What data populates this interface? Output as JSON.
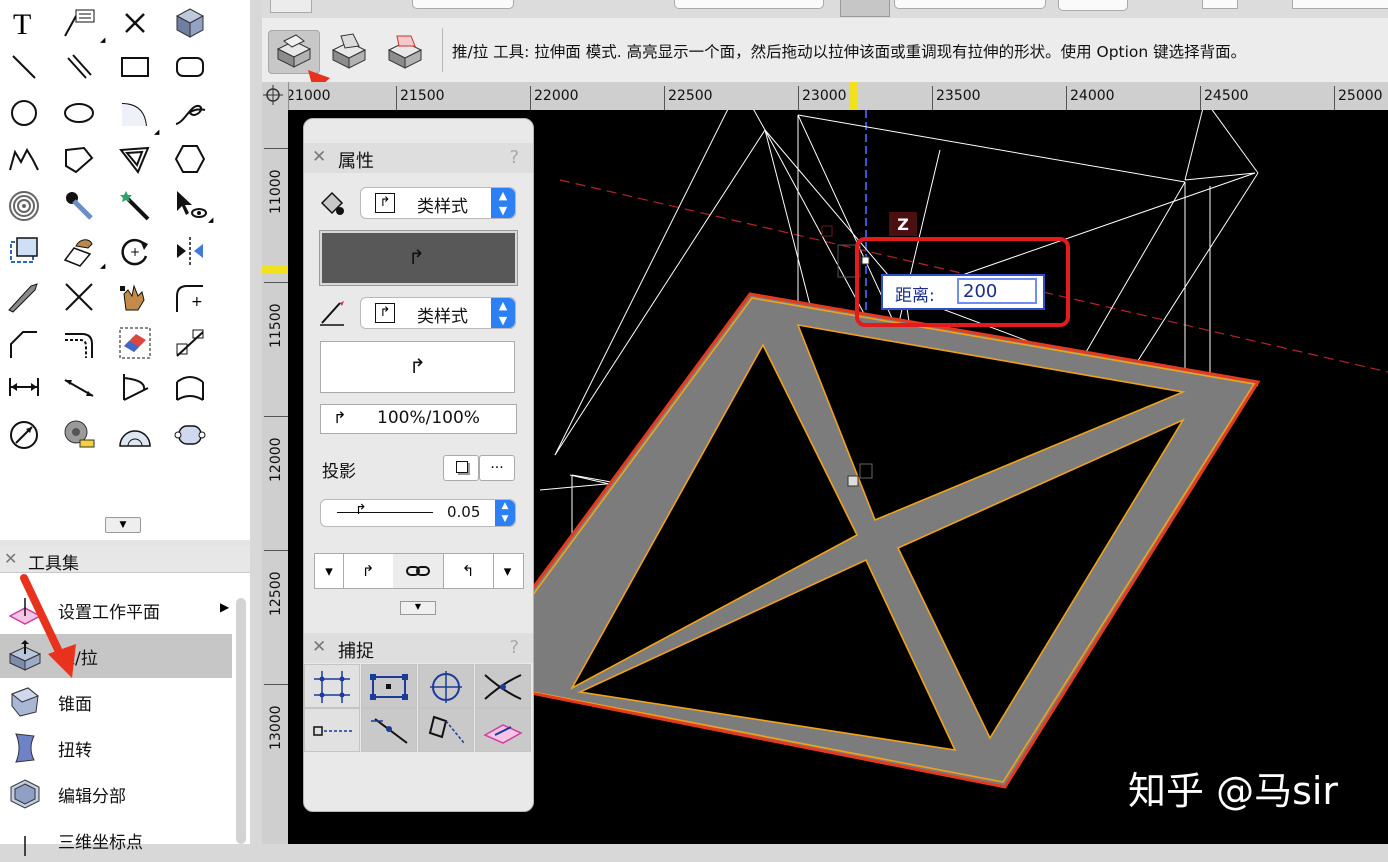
{
  "toolbar": {
    "hint_text": "推/拉 工具: 拉伸面 模式. 高亮显示一个面，然后拖动以拉伸该面或重调现有拉伸的形状。使用 Option 键选择背面。"
  },
  "palette": {
    "icons": [
      "text-icon",
      "callout-icon",
      "locus-icon",
      "3d-locus-icon",
      "line-icon",
      "double-line-icon",
      "rectangle-icon",
      "rounded-rectangle-icon",
      "circle-icon",
      "oval-icon",
      "arc-icon",
      "freehand-icon",
      "polyline-icon",
      "polygon-icon",
      "double-polygon-icon",
      "regular-polygon-icon",
      "spiral-icon",
      "eyedropper-icon",
      "visibility-wand-icon",
      "flyover-icon",
      "clip-icon",
      "attribute-mapping-icon",
      "rotate-icon",
      "mirror-icon",
      "knife-icon",
      "trim-icon",
      "reshape-icon",
      "fillet-icon",
      "chamfer-icon",
      "offset-icon",
      "eraser-icon",
      "connect-icon",
      "dimension-icon",
      "constrained-dimension-icon",
      "angle-icon",
      "arc-length-icon",
      "diameter-icon",
      "tape-measure-icon",
      "protractor-icon",
      "pill-icon"
    ]
  },
  "toolsets": {
    "title": "工具集",
    "items": [
      {
        "label": "设置工作平面",
        "icon": "working-plane-icon",
        "has_submenu": true
      },
      {
        "label": "推/拉",
        "icon": "push-pull-icon",
        "active": true
      },
      {
        "label": "锥面",
        "icon": "taper-face-icon"
      },
      {
        "label": "扭转",
        "icon": "twist-icon"
      },
      {
        "label": "编辑分部",
        "icon": "edit-subpart-icon"
      },
      {
        "label": "三维坐标点",
        "icon": "3d-point-icon"
      }
    ]
  },
  "ruler": {
    "top_ticks": [
      "21000",
      "21500",
      "22000",
      "22500",
      "23000",
      "23500",
      "24000",
      "24500",
      "25000"
    ],
    "left_ticks": [
      "11000",
      "11500",
      "12000",
      "12500",
      "13000"
    ]
  },
  "attributes": {
    "title": "属性",
    "help": "?",
    "fill_style": "类样式",
    "pen_style": "类样式",
    "opacity": "100%/100%",
    "shadow_label": "投影",
    "shadow_more": "...",
    "thickness": "0.05"
  },
  "snapping": {
    "title": "捕捉",
    "help": "?",
    "icons": [
      "snap-to-grid-icon",
      "snap-to-object-icon",
      "snap-to-angle-icon",
      "snap-to-intersection-icon",
      "snap-to-distance-icon",
      "smart-points-icon",
      "smart-edge-icon",
      "snap-to-surface-icon"
    ]
  },
  "canvas": {
    "axis_label": "Z",
    "distance_label": "距离:",
    "distance_value": "200",
    "watermark": "知乎 @马sir"
  },
  "colors": {
    "highlight_red": "#e31b1b",
    "selection_orange": "#f0a21a",
    "accent_blue": "#2d7ff5"
  }
}
